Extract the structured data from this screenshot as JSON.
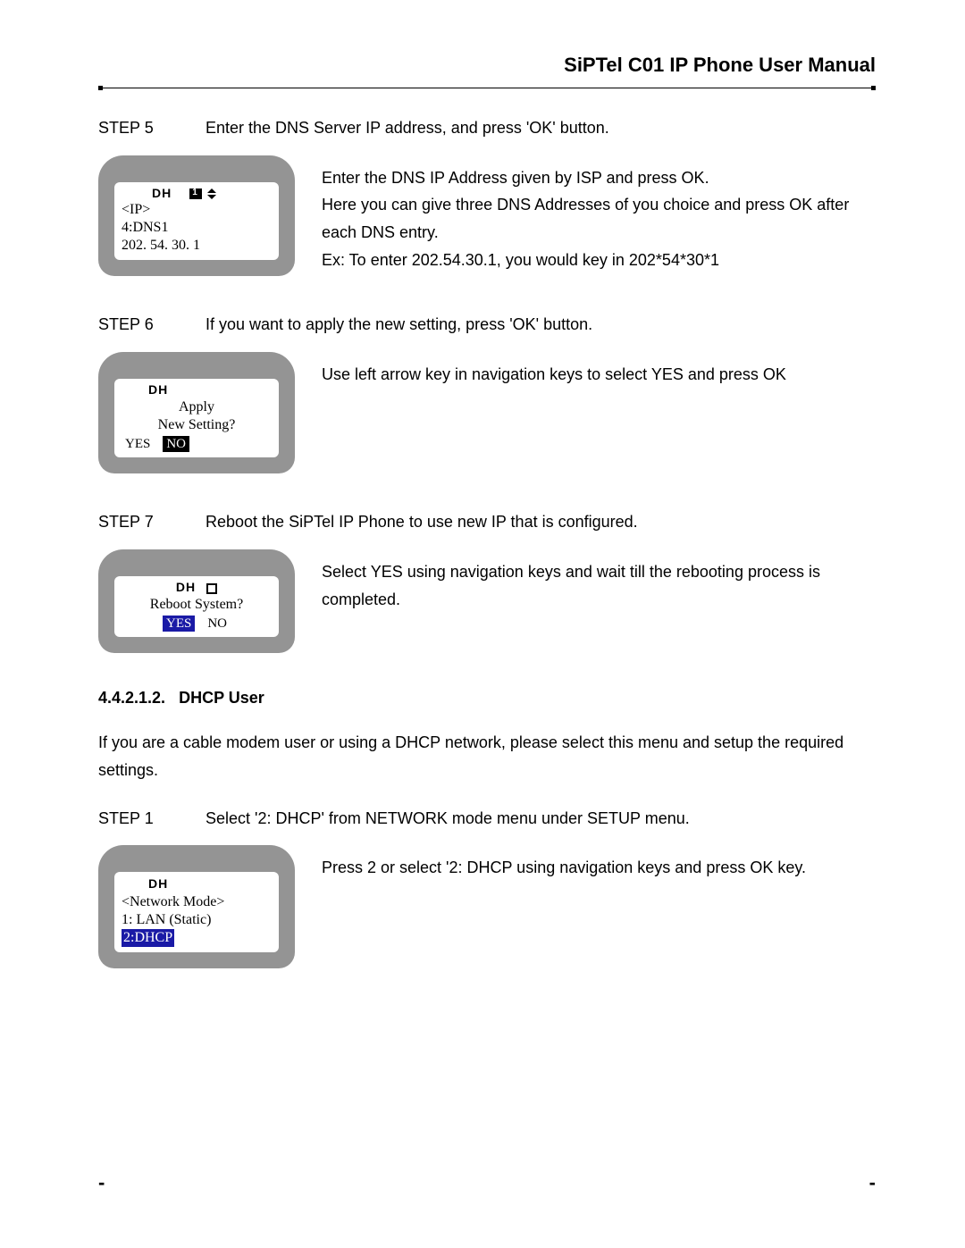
{
  "header": {
    "title": "SiPTel C01 IP Phone User Manual"
  },
  "steps": {
    "s5": {
      "label": "STEP 5",
      "text": "Enter the DNS Server IP address, and press 'OK' button.",
      "screen": {
        "dh": "DH",
        "line1": "<IP>",
        "line2": "4:DNS1",
        "line3": "202. 54. 30.  1"
      },
      "desc": {
        "l1": "Enter the DNS IP Address given by ISP and press OK.",
        "l2": "Here you can give three DNS Addresses of you choice and press OK after each DNS entry.",
        "l3": "Ex: To enter 202.54.30.1, you would key in 202*54*30*1"
      }
    },
    "s6": {
      "label": "STEP 6",
      "text": "If you want to apply the new setting, press 'OK' button.",
      "screen": {
        "dh": "DH",
        "line1": "Apply",
        "line2": "New Setting?",
        "yes": "YES",
        "no": "NO"
      },
      "desc": {
        "l1": "Use left arrow key in navigation keys to select YES and press OK"
      }
    },
    "s7": {
      "label": "STEP 7",
      "text": "Reboot the SiPTel IP Phone to use new IP that is configured.",
      "screen": {
        "dh": "DH",
        "line1": "Reboot System?",
        "yes": "YES",
        "no": "NO"
      },
      "desc": {
        "l1": "Select YES using navigation keys and wait till the rebooting process is completed."
      }
    }
  },
  "section": {
    "number": "4.4.2.1.2.",
    "title": "DHCP User",
    "intro": "If you are a cable modem user or using a DHCP network, please select this menu and setup the required settings."
  },
  "dhcp_s1": {
    "label": "STEP 1",
    "text": "Select '2: DHCP' from NETWORK mode menu under SETUP menu.",
    "screen": {
      "dh": "DH",
      "line1": "<Network Mode>",
      "line2": "1: LAN (Static)",
      "line3": "2:DHCP"
    },
    "desc": {
      "l1": "Press 2 or select '2: DHCP using navigation keys and press OK key."
    }
  },
  "footer": {
    "dash": "-"
  }
}
